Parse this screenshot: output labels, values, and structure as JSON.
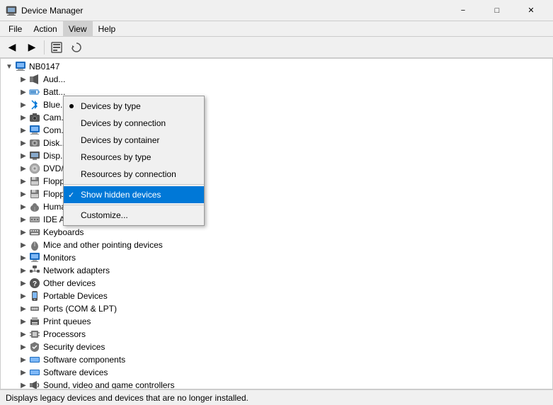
{
  "window": {
    "title": "Device Manager",
    "controls": {
      "minimize": "−",
      "maximize": "□",
      "close": "✕"
    }
  },
  "menubar": {
    "items": [
      {
        "id": "file",
        "label": "File"
      },
      {
        "id": "action",
        "label": "Action"
      },
      {
        "id": "view",
        "label": "View"
      },
      {
        "id": "help",
        "label": "Help"
      }
    ]
  },
  "toolbar": {
    "buttons": [
      {
        "id": "back",
        "icon": "←"
      },
      {
        "id": "forward",
        "icon": "→"
      },
      {
        "id": "properties",
        "icon": "⊞"
      },
      {
        "id": "sep1",
        "type": "sep"
      }
    ]
  },
  "view_menu": {
    "items": [
      {
        "id": "by-type",
        "label": "Devices by type",
        "type": "radio",
        "selected": true
      },
      {
        "id": "by-connection",
        "label": "Devices by connection",
        "type": "radio"
      },
      {
        "id": "by-container",
        "label": "Devices by container",
        "type": "radio"
      },
      {
        "id": "by-resource-type",
        "label": "Resources by type",
        "type": "radio"
      },
      {
        "id": "by-resource-connection",
        "label": "Resources by connection",
        "type": "radio"
      },
      {
        "id": "sep"
      },
      {
        "id": "show-hidden",
        "label": "Show hidden devices",
        "type": "check",
        "checked": true
      },
      {
        "id": "sep2"
      },
      {
        "id": "customize",
        "label": "Customize..."
      }
    ]
  },
  "tree": {
    "root": "NB0147",
    "items": [
      {
        "id": "root",
        "label": "NB0147",
        "indent": 0,
        "icon": "🖥",
        "expanded": true
      },
      {
        "id": "audio",
        "label": "Aud...",
        "indent": 1,
        "icon": "🔊"
      },
      {
        "id": "battery",
        "label": "Batt...",
        "indent": 1,
        "icon": "🔋"
      },
      {
        "id": "bluetooth",
        "label": "Blue...",
        "indent": 1,
        "icon": "📶"
      },
      {
        "id": "camera",
        "label": "Cam...",
        "indent": 1,
        "icon": "📷"
      },
      {
        "id": "computer",
        "label": "Com...",
        "indent": 1,
        "icon": "💻"
      },
      {
        "id": "disk",
        "label": "Disk...",
        "indent": 1,
        "icon": "💾"
      },
      {
        "id": "display",
        "label": "Disp...",
        "indent": 1,
        "icon": "🖥"
      },
      {
        "id": "dvd",
        "label": "DVD/CD-ROM drives",
        "indent": 1,
        "icon": "💿"
      },
      {
        "id": "floppy",
        "label": "Floppy disk drives",
        "indent": 1,
        "icon": "💾"
      },
      {
        "id": "floppy-ctrl",
        "label": "Floppy drive controllers",
        "indent": 1,
        "icon": "💾"
      },
      {
        "id": "hid",
        "label": "Human Interface Devices",
        "indent": 1,
        "icon": "🖱"
      },
      {
        "id": "ide",
        "label": "IDE ATA/ATAPI controllers",
        "indent": 1,
        "icon": "💾"
      },
      {
        "id": "keyboards",
        "label": "Keyboards",
        "indent": 1,
        "icon": "⌨"
      },
      {
        "id": "mice",
        "label": "Mice and other pointing devices",
        "indent": 1,
        "icon": "🖱"
      },
      {
        "id": "monitors",
        "label": "Monitors",
        "indent": 1,
        "icon": "🖥"
      },
      {
        "id": "network",
        "label": "Network adapters",
        "indent": 1,
        "icon": "🌐"
      },
      {
        "id": "other",
        "label": "Other devices",
        "indent": 1,
        "icon": "❓"
      },
      {
        "id": "portable",
        "label": "Portable Devices",
        "indent": 1,
        "icon": "📱"
      },
      {
        "id": "ports",
        "label": "Ports (COM & LPT)",
        "indent": 1,
        "icon": "🔌"
      },
      {
        "id": "print",
        "label": "Print queues",
        "indent": 1,
        "icon": "🖨"
      },
      {
        "id": "processors",
        "label": "Processors",
        "indent": 1,
        "icon": "⚙"
      },
      {
        "id": "security",
        "label": "Security devices",
        "indent": 1,
        "icon": "🔒"
      },
      {
        "id": "software-comp",
        "label": "Software components",
        "indent": 1,
        "icon": "📦"
      },
      {
        "id": "software-dev",
        "label": "Software devices",
        "indent": 1,
        "icon": "📦"
      },
      {
        "id": "sound",
        "label": "Sound, video and game controllers",
        "indent": 1,
        "icon": "🎵"
      }
    ]
  },
  "status_bar": {
    "text": "Displays legacy devices and devices that are no longer installed."
  }
}
